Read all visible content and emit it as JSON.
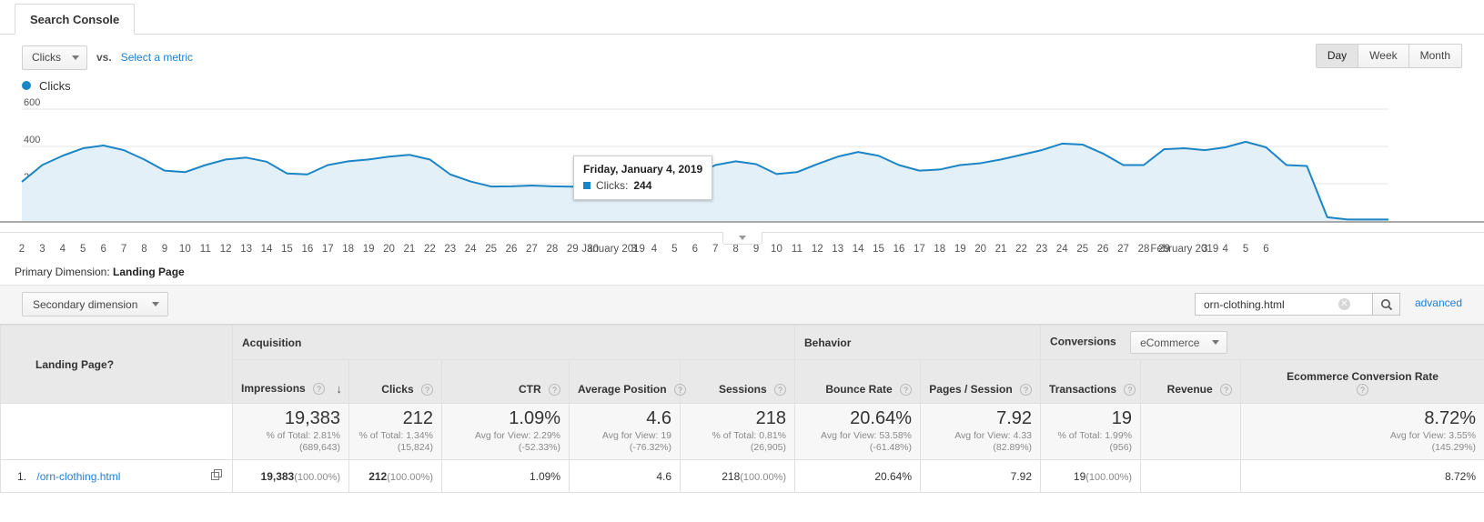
{
  "tab": {
    "label": "Search Console"
  },
  "metric_row": {
    "metric_selected": "Clicks",
    "vs_label": "vs.",
    "select_metric_link": "Select a metric"
  },
  "date_granularity": {
    "options": [
      "Day",
      "Week",
      "Month"
    ],
    "selected": "Day"
  },
  "legend": {
    "series_label": "Clicks",
    "color": "#1b85c5"
  },
  "tooltip": {
    "title": "Friday, January 4, 2019",
    "metric": "Clicks:",
    "value": "244"
  },
  "primary_dimension": {
    "label": "Primary Dimension:",
    "value": "Landing Page"
  },
  "secondary_dimension": {
    "label": "Secondary dimension"
  },
  "search": {
    "value": "orn-clothing.html",
    "placeholder": "",
    "advanced_label": "advanced"
  },
  "table": {
    "groups": [
      {
        "label": "",
        "span": 1
      },
      {
        "label": "Acquisition",
        "span": 5
      },
      {
        "label": "Behavior",
        "span": 2
      },
      {
        "label": "Conversions",
        "span": 4,
        "select": "eCommerce"
      }
    ],
    "lead_header": "Landing Page",
    "columns": [
      "Impressions",
      "Clicks",
      "CTR",
      "Average Position",
      "Sessions",
      "Bounce Rate",
      "Pages / Session",
      "Transactions",
      "Revenue",
      "Ecommerce Conversion Rate"
    ],
    "sorted_column": "Impressions",
    "sort_direction": "desc",
    "summary": [
      {
        "value": "19,383",
        "sub1": "% of Total: 2.81%",
        "sub2": "(689,643)"
      },
      {
        "value": "212",
        "sub1": "% of Total: 1.34%",
        "sub2": "(15,824)"
      },
      {
        "value": "1.09%",
        "sub1": "Avg for View: 2.29%",
        "sub2": "(-52.33%)"
      },
      {
        "value": "4.6",
        "sub1": "Avg for View: 19",
        "sub2": "(-76.32%)"
      },
      {
        "value": "218",
        "sub1": "% of Total: 0.81%",
        "sub2": "(26,905)"
      },
      {
        "value": "20.64%",
        "sub1": "Avg for View: 53.58%",
        "sub2": "(-61.48%)"
      },
      {
        "value": "7.92",
        "sub1": "Avg for View: 4.33",
        "sub2": "(82.89%)"
      },
      {
        "value": "19",
        "sub1": "% of Total: 1.99%",
        "sub2": "(956)"
      },
      {
        "value": "",
        "sub1": "",
        "sub2": ""
      },
      {
        "value": "8.72%",
        "sub1": "Avg for View: 3.55%",
        "sub2": "(145.29%)"
      }
    ],
    "rows": [
      {
        "index": "1.",
        "landing_page": "/orn-clothing.html",
        "cells": [
          {
            "main": "19,383",
            "pct": "(100.00%)"
          },
          {
            "main": "212",
            "pct": "(100.00%)"
          },
          {
            "main": "1.09%",
            "pct": ""
          },
          {
            "main": "4.6",
            "pct": ""
          },
          {
            "main": "218",
            "pct": "(100.00%)"
          },
          {
            "main": "20.64%",
            "pct": ""
          },
          {
            "main": "7.92",
            "pct": ""
          },
          {
            "main": "19",
            "pct": "(100.00%)"
          },
          {
            "main": "",
            "pct": ""
          },
          {
            "main": "8.72%",
            "pct": ""
          }
        ]
      }
    ]
  },
  "chart_data": {
    "type": "area",
    "title": "Clicks",
    "xlabel": "",
    "ylabel": "",
    "ylim": [
      0,
      600
    ],
    "yticks": [
      200,
      400,
      600
    ],
    "grid": true,
    "line_color": "#1b85c5",
    "fill_color": "#e3f0f8",
    "highlight_point": {
      "x_label": "January 4, 2019",
      "y": 244
    },
    "x_tick_labels": [
      "2",
      "3",
      "4",
      "5",
      "6",
      "7",
      "8",
      "9",
      "10",
      "11",
      "12",
      "13",
      "14",
      "15",
      "16",
      "17",
      "18",
      "19",
      "20",
      "21",
      "22",
      "23",
      "24",
      "25",
      "26",
      "27",
      "28",
      "29",
      "30",
      "January 2019",
      "3",
      "4",
      "5",
      "6",
      "7",
      "8",
      "9",
      "10",
      "11",
      "12",
      "13",
      "14",
      "15",
      "16",
      "17",
      "18",
      "19",
      "20",
      "21",
      "22",
      "23",
      "24",
      "25",
      "26",
      "27",
      "28",
      "29",
      "February 2019",
      "3",
      "4",
      "5",
      "6"
    ],
    "series": [
      {
        "name": "Clicks",
        "values": [
          210,
          300,
          350,
          390,
          405,
          380,
          330,
          270,
          262,
          300,
          330,
          340,
          318,
          255,
          250,
          300,
          320,
          330,
          345,
          355,
          330,
          250,
          212,
          185,
          186,
          190,
          186,
          184,
          200,
          205,
          198,
          188,
          190,
          244,
          300,
          320,
          305,
          252,
          262,
          305,
          345,
          370,
          350,
          300,
          270,
          276,
          300,
          310,
          330,
          355,
          380,
          415,
          410,
          362,
          300,
          300,
          385,
          390,
          380,
          395,
          425,
          395,
          300,
          295,
          20,
          8,
          8,
          8
        ]
      }
    ]
  }
}
